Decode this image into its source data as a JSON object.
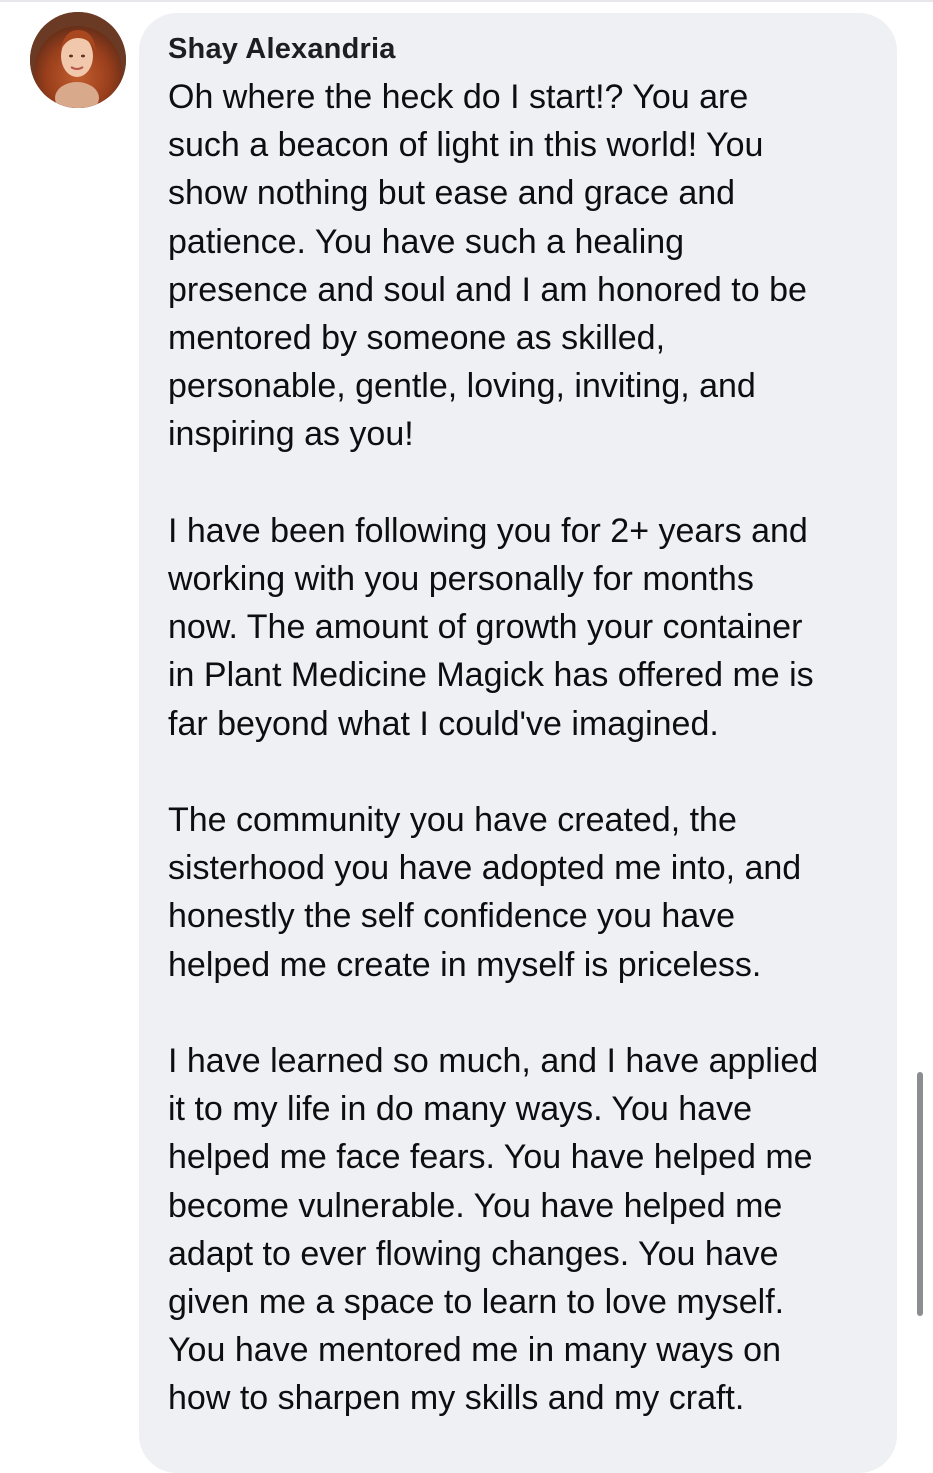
{
  "comment": {
    "author": "Shay Alexandria",
    "avatar_icon": "profile-photo",
    "paragraphs": [
      [
        "Oh where the heck do I start!? You are",
        "such a beacon of light in this world! You",
        "show nothing but ease and grace and",
        "patience. You have such a healing",
        "presence and soul and I am honored to be",
        "mentored by someone as skilled,",
        "personable, gentle, loving, inviting, and",
        "inspiring as you!"
      ],
      [
        "I have been following you for 2+ years and",
        "working with you personally for months",
        "now. The amount of growth your container",
        "in Plant Medicine Magick has offered me is",
        "far beyond what I could've imagined."
      ],
      [
        "The community you have created, the",
        "sisterhood you have adopted me into, and",
        "honestly the self confidence you have",
        "helped me create in myself is priceless."
      ],
      [
        "I have learned so much, and I have applied",
        "it to my life in do many ways. You have",
        "helped me face fears. You have helped me",
        "become vulnerable. You have helped me",
        "adapt to ever flowing changes. You have",
        "given me a space to learn to love myself.",
        "You have mentored me in many ways on",
        "how to sharpen my skills and my craft."
      ]
    ]
  },
  "colors": {
    "bubble": "#eff0f4",
    "text": "#0d0e10",
    "scrollbar": "#8c8d90"
  }
}
